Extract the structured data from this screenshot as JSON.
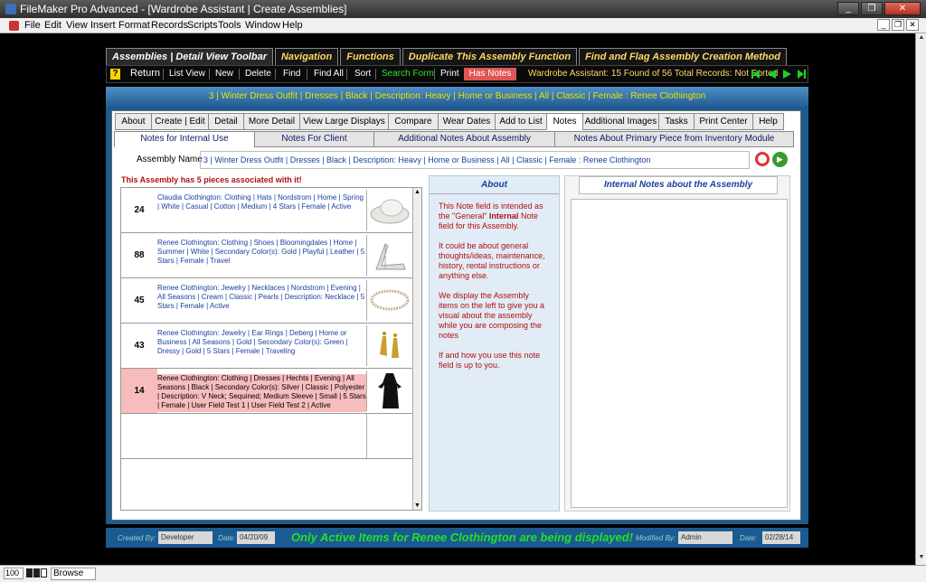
{
  "window": {
    "title": "FileMaker Pro Advanced - [Wardrobe Assistant | Create Assemblies]",
    "buttons": [
      "_",
      "❐",
      "✕"
    ]
  },
  "menu": {
    "items": [
      "File",
      "Edit",
      "View",
      "Insert",
      "Format",
      "Records",
      "Scripts",
      "Tools",
      "Window",
      "Help"
    ],
    "mdi_buttons": [
      "_",
      "❐",
      "✕"
    ]
  },
  "top_tabs": [
    "Assemblies | Detail View Toolbar",
    "Navigation",
    "Functions",
    "Duplicate This Assembly Function",
    "Find and Flag Assembly Creation Method"
  ],
  "toolbar": {
    "help": "?",
    "return": "Return",
    "list_view": "List View",
    "new": "New",
    "delete": "Delete",
    "find": "Find",
    "find_all": "Find All",
    "sort": "Sort",
    "search_form": "Search Form",
    "print": "Print",
    "has_notes": "Has Notes",
    "status": "Wardrobe Assistant: 15 Found of 56 Total Records: Not Sorted"
  },
  "banner": "3 | Winter Dress Outfit | Dresses | Black | Description: Heavy | Home or Business | All | Classic | Female : Renee Clothington",
  "panel_tabs": [
    "About",
    "Create | Edit",
    "Detail",
    "More Detail",
    "View Large Displays",
    "Compare",
    "Wear Dates",
    "Add to List",
    "Notes",
    "Additional Images",
    "Tasks",
    "Print Center",
    "Help"
  ],
  "sub_tabs": [
    "Notes for Internal Use",
    "Notes For Client",
    "Additional Notes About Assembly",
    "Notes About Primary Piece from Inventory Module"
  ],
  "assembly": {
    "label": "Assembly Name",
    "value": "3 | Winter Dress Outfit | Dresses | Black | Description: Heavy | Home or Business | All | Classic | Female : Renee Clothington"
  },
  "pieces": {
    "count_text": "This Assembly has 5 pieces associated with it!",
    "items": [
      {
        "num": "24",
        "desc": "Claudia Clothington: Clothing | Hats | Nordstrom | Home | Spring | White | Casual | Cotton | Medium | 4 Stars | Female | Active"
      },
      {
        "num": "88",
        "desc": "Renee Clothington: Clothing | Shoes | Bloomingdales | Home | Summer | White | Secondary Color(s): Gold | Playful | Leather | 5 Stars | Female | Travel"
      },
      {
        "num": "45",
        "desc": "Renee Clothington: Jewelry | Necklaces | Nordstrom | Evening | All Seasons | Cream | Classic | Pearls | Description: Necklace | 5 Stars | Female | Active"
      },
      {
        "num": "43",
        "desc": "Renee Clothington: Jewelry | Ear Rings | Deberg | Home or Business | All Seasons | Gold | Secondary Color(s): Green | Dressy | Gold | 5 Stars | Female | Traveling"
      },
      {
        "num": "14",
        "desc": "Renee Clothington: Clothing | Dresses | Hechts | Evening | All Seasons | Black | Secondary Color(s): Silver | Classic | Polyester | Description: V Neck; Sequined; Medium Sleeve | Small | 5 Stars | Female | User Field Test 1 | User Field Test 2 | Active"
      }
    ]
  },
  "about": {
    "header": "About",
    "p1a": "This Note field is intended as the \"General\" ",
    "p1b": "Internal",
    "p1c": " Note field for this Assembly.",
    "p2": "It could be about general thoughts/ideas, maintenance, history, rental instructions or anything else.",
    "p3": "We display the Assembly items on the left to give you a visual about the assembly while you are composing the notes",
    "p4": "If and how you use this note field is up to you."
  },
  "notes": {
    "header": "Internal Notes about the Assembly",
    "value": ""
  },
  "footer": {
    "created_by_label": "Created By:",
    "created_by": "Developer",
    "date_label1": "Date:",
    "date1": "04/20/09",
    "message": "Only Active Items for Renee Clothington are being displayed!",
    "modified_by_label": "Modified By:",
    "modified_by": "Admin",
    "date_label2": "Date:",
    "date2": "02/28/14"
  },
  "statusbar": {
    "zoom": "100",
    "mode": "Browse"
  },
  "colors": {
    "accent_blue": "#1c5a92",
    "banner_text": "#e6e600",
    "has_notes": "#e25555",
    "selected_row": "#f7bcbc",
    "message_green": "#22e022"
  }
}
